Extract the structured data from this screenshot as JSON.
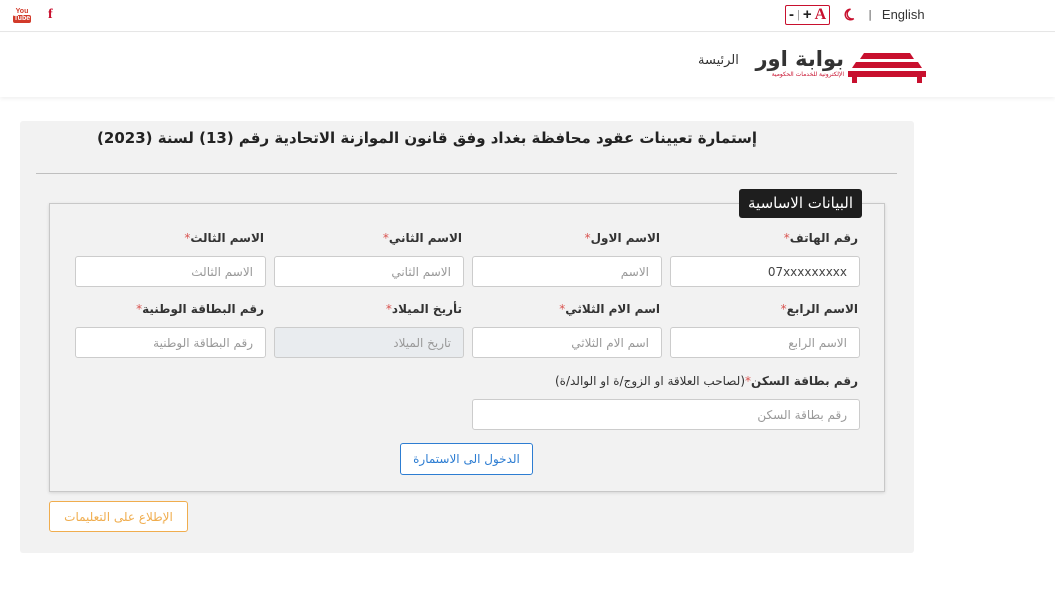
{
  "topbar": {
    "social": [
      "youtube-icon",
      "facebook-icon"
    ],
    "youtube": {
      "top": "You",
      "bottom": "Tube"
    },
    "facebook": "f",
    "font_decrease": "-",
    "font_separator": "|",
    "font_increase": "+",
    "font_reset": "A",
    "theme_icon": "moon-icon",
    "separator": "|",
    "language": "English"
  },
  "header": {
    "brand": "بوابة اور",
    "brand_sub": "الإلكترونية للخدمات الحكومية",
    "home": "الرئيسة"
  },
  "form": {
    "title": "إستمارة تعيينات عقود محافظة بغداد وفق قانون الموازنة الاتحادية رقم (13) لسنة (2023)",
    "section": "البيانات الاساسية",
    "required_mark": "*",
    "fields": {
      "phone": {
        "label": "رقم الهاتف",
        "value": "07xxxxxxxxx"
      },
      "first_name": {
        "label": "الاسم الاول",
        "placeholder": "الاسم"
      },
      "second_name": {
        "label": "الاسم الثاني",
        "placeholder": "الاسم الثاني"
      },
      "third_name": {
        "label": "الاسم الثالث",
        "placeholder": "الاسم الثالث"
      },
      "fourth_name": {
        "label": "الاسم الرابع",
        "placeholder": "الاسم الرابع"
      },
      "mother_name": {
        "label": "اسم الام الثلاثي",
        "placeholder": "اسم الام الثلاثي"
      },
      "birth_date": {
        "label": "تأريخ الميلاد",
        "placeholder": "تاريخ الميلاد"
      },
      "national_id": {
        "label": "رقم البطاقة الوطنية",
        "placeholder": "رقم البطاقة الوطنية"
      },
      "residence_card": {
        "label": "رقم بطاقة السكن",
        "note": "(لصاحب العلاقة او الزوج/ة او الوالد/ة)",
        "placeholder": "رقم بطاقة السكن"
      }
    },
    "submit": "الدخول الى الاستمارة",
    "instructions": "الإطلاع على التعليمات"
  }
}
